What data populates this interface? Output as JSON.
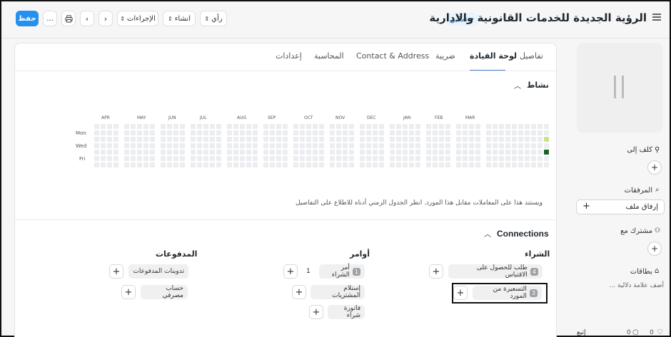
{
  "header": {
    "title": "الرؤية الجديدة للخدمات القانونية والادارية",
    "status": "تمكين",
    "save_label": "حفظ",
    "more_label": "...",
    "actions_label": "الإجراءات",
    "create_label": "انشاء",
    "view_label": "رأي"
  },
  "tabs": [
    {
      "label": "تفاصيل"
    },
    {
      "label": "لوحة القيادة"
    },
    {
      "label": "ضريبة"
    },
    {
      "label": "Contact & Address"
    },
    {
      "label": "المحاسبة"
    },
    {
      "label": "إعدادات"
    }
  ],
  "activity": {
    "title": "نشاط",
    "months": [
      "APR",
      "MAY",
      "JUN",
      "JUL",
      "AUG",
      "SEP",
      "OCT",
      "NOV",
      "DEC",
      "JAN",
      "FEB",
      "MAR"
    ],
    "days": [
      "Mon",
      "Wed",
      "Fri"
    ],
    "note": "ويستند هذا على المعاملات مقابل هذا المورد. انظر الجدول الزمني أدناه للاطلاع على التفاصيل",
    "heat_colors": {
      "empty": "#ebedf0",
      "light": "#c6e48b",
      "dark": "#196127"
    }
  },
  "connections": {
    "title": "Connections",
    "groups": [
      {
        "title": "الشراء",
        "items": [
          {
            "count": "4",
            "label": "طلب للحصول على الاقتباس"
          },
          {
            "count": "3",
            "label": "التسعيرة من المورد"
          }
        ]
      },
      {
        "title": "أوامر",
        "items": [
          {
            "count": "1",
            "label": "أمر الشراء",
            "extra": "1"
          },
          {
            "label": "إستلام المشتريات"
          },
          {
            "label": "فاتورة شراء"
          }
        ]
      },
      {
        "title": "المدفوعات",
        "items": [
          {
            "label": "تدوينات المدفوعات"
          },
          {
            "label": "حساب مصرفي"
          }
        ]
      }
    ]
  },
  "sidebar": {
    "assigned_label": "كلف إلى",
    "attachments_label": "المرفقات",
    "attach_file_label": "إرفاق ملف",
    "shared_label": "مشترك مع",
    "tags_label": "بطاقات",
    "add_tag_placeholder": "أضف علامة دلالية ...",
    "follow_label": "إتبع",
    "likes": "0",
    "comments": "0"
  }
}
